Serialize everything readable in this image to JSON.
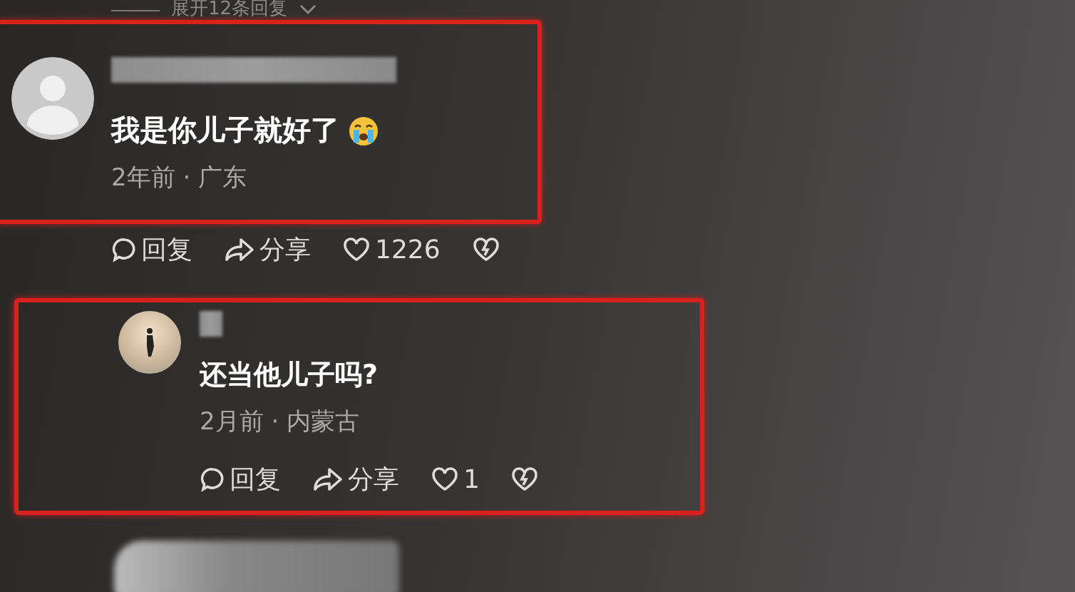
{
  "expand_replies": {
    "label": "展开12条回复"
  },
  "comments": [
    {
      "avatar": {
        "kind": "default"
      },
      "name_redacted": true,
      "highlighted": true,
      "text": "我是你儿子就好了",
      "emoji": {
        "kind": "crying"
      },
      "meta": "2年前 · 广东",
      "reply": "回复",
      "share": "分享",
      "likes": "1226",
      "children": [
        {
          "avatar": {
            "kind": "photo"
          },
          "name_redacted": true,
          "highlighted": true,
          "text": "还当他儿子吗?",
          "meta": "2月前 · 内蒙古",
          "reply": "回复",
          "share": "分享",
          "likes": "1"
        },
        {
          "kind": "blurred"
        }
      ]
    }
  ]
}
